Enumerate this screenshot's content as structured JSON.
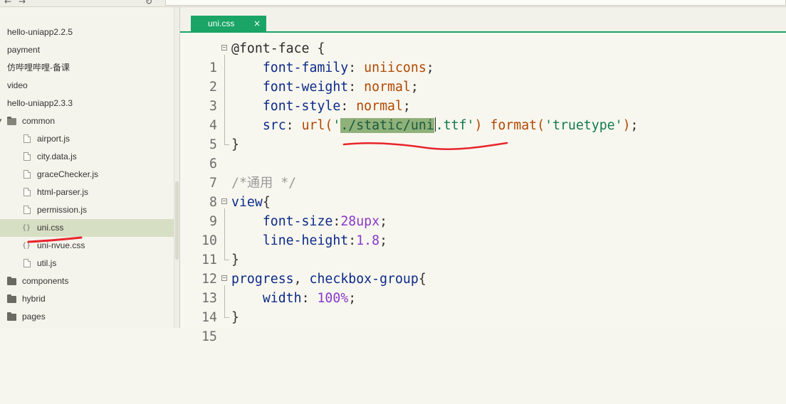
{
  "topbar": {
    "back_glyph": "←",
    "forward_glyph": "→",
    "refresh_glyph": "↻"
  },
  "sidebar": {
    "items": [
      {
        "label": "hello-uniapp2.2.5",
        "type": "project"
      },
      {
        "label": "payment",
        "type": "project"
      },
      {
        "label": "仿哔哩哔哩-备课",
        "type": "project"
      },
      {
        "label": "video",
        "type": "project"
      },
      {
        "label": "hello-uniapp2.3.3",
        "type": "project"
      },
      {
        "label": "common",
        "type": "folder-open"
      },
      {
        "label": "airport.js",
        "type": "file"
      },
      {
        "label": "city.data.js",
        "type": "file"
      },
      {
        "label": "graceChecker.js",
        "type": "file"
      },
      {
        "label": "html-parser.js",
        "type": "file"
      },
      {
        "label": "permission.js",
        "type": "file"
      },
      {
        "label": "uni.css",
        "type": "css",
        "selected": true
      },
      {
        "label": "uni-nvue.css",
        "type": "css"
      },
      {
        "label": "util.js",
        "type": "file"
      },
      {
        "label": "components",
        "type": "folder"
      },
      {
        "label": "hybrid",
        "type": "folder"
      },
      {
        "label": "pages",
        "type": "folder"
      }
    ],
    "css_icon_glyph": "{}",
    "expand_arrow": "▾"
  },
  "editor": {
    "tab": {
      "label": "uni.css",
      "close_glyph": "×"
    },
    "line_numbers": [
      "1",
      "2",
      "3",
      "4",
      "5",
      "6",
      "7",
      "8",
      "9",
      "10",
      "11",
      "12",
      "13",
      "14",
      "15"
    ],
    "code": {
      "l1": {
        "selector": "@font-face",
        "brace": " {"
      },
      "l2": {
        "prop": "font-family",
        "colon": ": ",
        "value": "uniicons",
        "semi": ";"
      },
      "l3": {
        "prop": "font-weight",
        "colon": ": ",
        "value": "normal",
        "semi": ";"
      },
      "l4": {
        "prop": "font-style",
        "colon": ": ",
        "value": "normal",
        "semi": ";"
      },
      "l5": {
        "prop": "src",
        "colon": ": ",
        "fn1": "url(",
        "q1": "'",
        "str_sel": "./static/uni",
        "str_rest": ".ttf'",
        "close1": ")",
        "sp": " ",
        "fn2": "format(",
        "str2": "'truetype'",
        "close2": ")",
        "semi": ";"
      },
      "l6": {
        "brace": "}"
      },
      "l8": {
        "comment": "/*通用 */"
      },
      "l9": {
        "selector": "view",
        "brace": "{"
      },
      "l10": {
        "prop": "font-size",
        "colon": ":",
        "value": "28upx",
        "semi": ";"
      },
      "l11": {
        "prop": "line-height",
        "colon": ":",
        "value": "1.8",
        "semi": ";"
      },
      "l12": {
        "brace": "}"
      },
      "l13": {
        "sel1": "progress",
        "comma": ", ",
        "sel2": "checkbox-group",
        "brace": "{"
      },
      "l14": {
        "prop": "width",
        "colon": ": ",
        "value": "100%",
        "semi": ";"
      },
      "l15": {
        "brace": "}"
      }
    }
  },
  "colors": {
    "accent_green": "#1aa566",
    "selection": "#8fb17a",
    "sidebar_selected": "#d6dfc3",
    "annotation_red": "#e8242b"
  }
}
